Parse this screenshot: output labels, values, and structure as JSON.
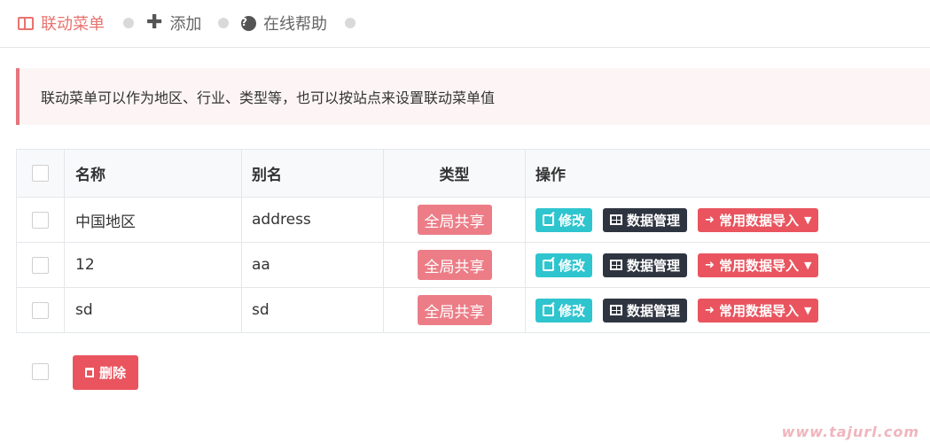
{
  "nav": {
    "tabs": [
      {
        "label": "联动菜单",
        "icon": "columns-icon",
        "active": true
      },
      {
        "label": "添加",
        "icon": "plus-icon",
        "active": false
      },
      {
        "label": "在线帮助",
        "icon": "help-icon",
        "active": false
      }
    ]
  },
  "alert": {
    "text": "联动菜单可以作为地区、行业、类型等，也可以按站点来设置联动菜单值"
  },
  "table": {
    "columns": [
      "名称",
      "别名",
      "类型",
      "操作"
    ],
    "rows": [
      {
        "name": "中国地区",
        "alias": "address",
        "type": "全局共享"
      },
      {
        "name": "12",
        "alias": "aa",
        "type": "全局共享"
      },
      {
        "name": "sd",
        "alias": "sd",
        "type": "全局共享"
      }
    ],
    "actions": {
      "edit": "修改",
      "data": "数据管理",
      "import": "常用数据导入"
    }
  },
  "footer": {
    "delete_label": "删除"
  },
  "watermark": "www.tajurl.com",
  "colors": {
    "accent": "#e8736f",
    "edit": "#2ec5cf",
    "dark": "#2f3540",
    "danger": "#e9545e",
    "badge": "#ec7d87"
  }
}
